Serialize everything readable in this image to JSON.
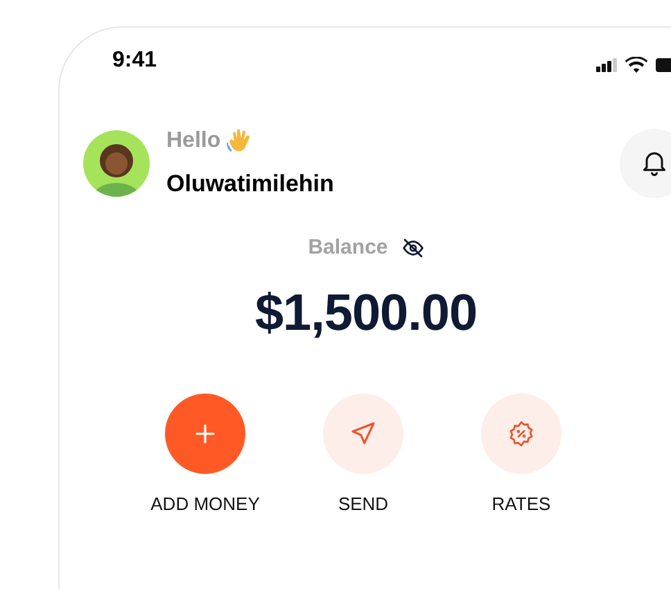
{
  "status_bar": {
    "time": "9:41"
  },
  "greeting": {
    "hello": "Hello",
    "name": "Oluwatimilehin"
  },
  "balance": {
    "label": "Balance",
    "amount": "$1,500.00"
  },
  "actions": [
    {
      "label": "ADD MONEY",
      "kind": "add",
      "primary": true
    },
    {
      "label": "SEND",
      "kind": "send",
      "primary": false
    },
    {
      "label": "RATES",
      "kind": "rates",
      "primary": false
    }
  ]
}
